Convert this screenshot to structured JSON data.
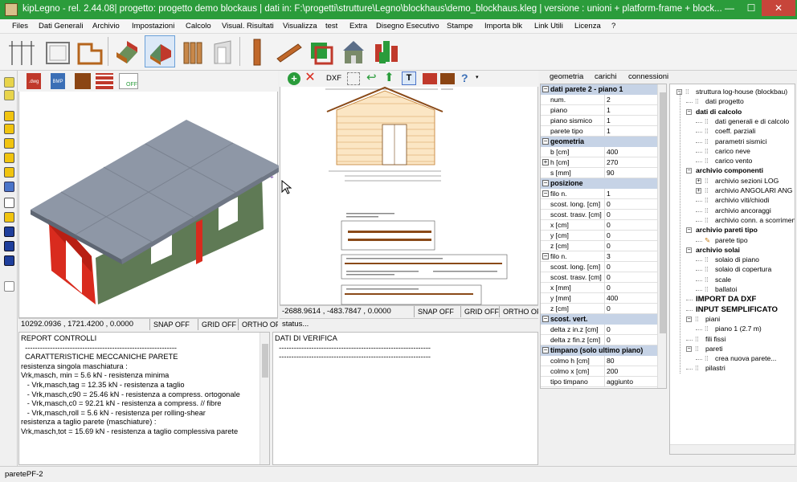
{
  "window": {
    "title": "kipLegno - rel. 2.44.08| progetto: progetto demo blockaus | dati in: F:\\progetti\\strutture\\Legno\\blockhaus\\demo_blockhaus.kleg | versione  : unioni + platform-frame + block...",
    "minimize": "—",
    "maximize": "☐",
    "close": "✕"
  },
  "menu": [
    "Files",
    "Dati Generali",
    "Archivio",
    "Impostazioni",
    "Calcolo",
    "Visual. Risultati",
    "Visualizza",
    "test",
    "Extra",
    "Disegno Esecutivo",
    "Stampe",
    "Importa blk",
    "Link Utili",
    "Licenza",
    "?"
  ],
  "toolbar3d": {
    "dwg": ".dwg",
    "bmp": "BMP",
    "off": "OFF"
  },
  "toolbar2d": {
    "dxf": "DXF"
  },
  "tabs": [
    "geometria",
    "carichi",
    "connessioni"
  ],
  "status3d": {
    "coords": "10292.0936 , 1721.4200 , 0.0000",
    "snap": "SNAP OFF",
    "grid": "GRID OFF",
    "ortho": "ORTHO OF"
  },
  "status2d": {
    "coords": "-2688.9614 , -483.7847 , 0.0000",
    "snap": "SNAP OFF",
    "grid": "GRID OFF",
    "ortho": "ORTHO OF"
  },
  "report": {
    "lines": [
      "REPORT CONTROLLI",
      "",
      "  -------------------------------------------------------------",
      "",
      "  CARATTERISTICHE MECCANICHE PARETE",
      "",
      "resistenza singola maschiatura :",
      "Vrk,masch, min = 5.6 kN - resistenza minima",
      "   - Vrk,masch,tag = 12.35 kN - resistenza a taglio",
      "   - Vrk,masch,c90 = 25.46 kN - resistenza a compress. ortogonale",
      "   - Vrk,masch,c0 = 92.21 kN - resistenza a compress. // fibre",
      "   - Vrk,masch,roll = 5.6 kN - resistenza per rolling-shear",
      "",
      "resistenza a taglio parete (maschiature) :",
      "Vrk,masch,tot = 15.69 kN - resistenza a taglio complessiva parete"
    ]
  },
  "verifica": {
    "lines": [
      "DATI DI VERIFICA",
      "",
      "  -------------------------------------------------------------",
      "",
      "  -------------------------------------------------------------"
    ],
    "status": "status..."
  },
  "props": [
    {
      "cat": "dati parete 2 - piano 1"
    },
    {
      "k": "num.",
      "v": "2"
    },
    {
      "k": "piano",
      "v": "1"
    },
    {
      "k": "piano sismico",
      "v": "1"
    },
    {
      "k": "parete tipo",
      "v": "1"
    },
    {
      "cat": "geometria"
    },
    {
      "k": "b [cm]",
      "v": "400"
    },
    {
      "k": "h [cm]",
      "v": "270",
      "exp": "+"
    },
    {
      "k": "s [mm]",
      "v": "90"
    },
    {
      "cat": "posizione"
    },
    {
      "k": "filo n.",
      "v": "1",
      "exp": "-"
    },
    {
      "k": "  scost. long. [cm]",
      "v": "0"
    },
    {
      "k": "  scost. trasv. [cm]",
      "v": "0"
    },
    {
      "k": "  x [cm]",
      "v": "0"
    },
    {
      "k": "  y [cm]",
      "v": "0"
    },
    {
      "k": "  z [cm]",
      "v": "0"
    },
    {
      "k": "filo n.",
      "v": "3",
      "exp": "-"
    },
    {
      "k": "  scost. long. [cm]",
      "v": "0"
    },
    {
      "k": "  scost. trasv. [cm]",
      "v": "0"
    },
    {
      "k": "  x [mm]",
      "v": "0"
    },
    {
      "k": "  y [mm]",
      "v": "400"
    },
    {
      "k": "  z [cm]",
      "v": "0"
    },
    {
      "cat": "scost. vert."
    },
    {
      "k": "delta z in.z [cm]",
      "v": "0"
    },
    {
      "k": "delta z fin.z [cm]",
      "v": "0"
    },
    {
      "cat": "timpano (solo ultimo piano)"
    },
    {
      "k": "colmo h [cm]",
      "v": "80"
    },
    {
      "k": "colmo x [cm]",
      "v": "200"
    },
    {
      "k": "tipo timpano",
      "v": "aggiunto"
    }
  ],
  "tree": [
    {
      "t": "struttura log-house (blockbau)",
      "lvl": 0,
      "box": "-"
    },
    {
      "t": "dati progetto",
      "lvl": 1
    },
    {
      "t": "dati di calcolo",
      "lvl": 1,
      "b": true,
      "box": "-"
    },
    {
      "t": "dati generali e di calcolo",
      "lvl": 2
    },
    {
      "t": "coeff. parziali",
      "lvl": 2
    },
    {
      "t": "parametri sismici",
      "lvl": 2
    },
    {
      "t": "carico neve",
      "lvl": 2
    },
    {
      "t": "carico vento",
      "lvl": 2
    },
    {
      "t": "archivio componenti",
      "lvl": 1,
      "b": true,
      "box": "-"
    },
    {
      "t": "archivio sezioni LOG",
      "lvl": 2,
      "box": "+"
    },
    {
      "t": "archivio ANGOLARI ANG",
      "lvl": 2,
      "box": "+"
    },
    {
      "t": "archivio viti/chiodi",
      "lvl": 2
    },
    {
      "t": "archivio ancoraggi",
      "lvl": 2
    },
    {
      "t": "archivio conn. a scorrimento",
      "lvl": 2
    },
    {
      "t": "archivio pareti tipo",
      "lvl": 1,
      "b": true,
      "box": "-"
    },
    {
      "t": "parete tipo",
      "lvl": 2,
      "pencil": true
    },
    {
      "t": "archivio solai",
      "lvl": 1,
      "b": true,
      "box": "-"
    },
    {
      "t": "solaio di piano",
      "lvl": 2
    },
    {
      "t": "solaio di copertura",
      "lvl": 2
    },
    {
      "t": "scale",
      "lvl": 2
    },
    {
      "t": "ballatoi",
      "lvl": 2
    },
    {
      "t": "IMPORT DA DXF",
      "lvl": 1,
      "b": true,
      "big": true
    },
    {
      "t": "INPUT SEMPLIFICATO",
      "lvl": 1,
      "b": true,
      "big": true
    },
    {
      "t": "piani",
      "lvl": 1,
      "box": "-"
    },
    {
      "t": "piano 1 (2.7 m)",
      "lvl": 2
    },
    {
      "t": "fili fissi",
      "lvl": 1
    },
    {
      "t": "pareti",
      "lvl": 1,
      "box": "-"
    },
    {
      "t": "crea nuova parete...",
      "lvl": 2
    },
    {
      "t": "pilastri",
      "lvl": 1
    }
  ],
  "footer": {
    "text": "paretePF-2"
  },
  "colors": {
    "titlebar": "#2b9c3b",
    "category": "#c6d3e6"
  }
}
